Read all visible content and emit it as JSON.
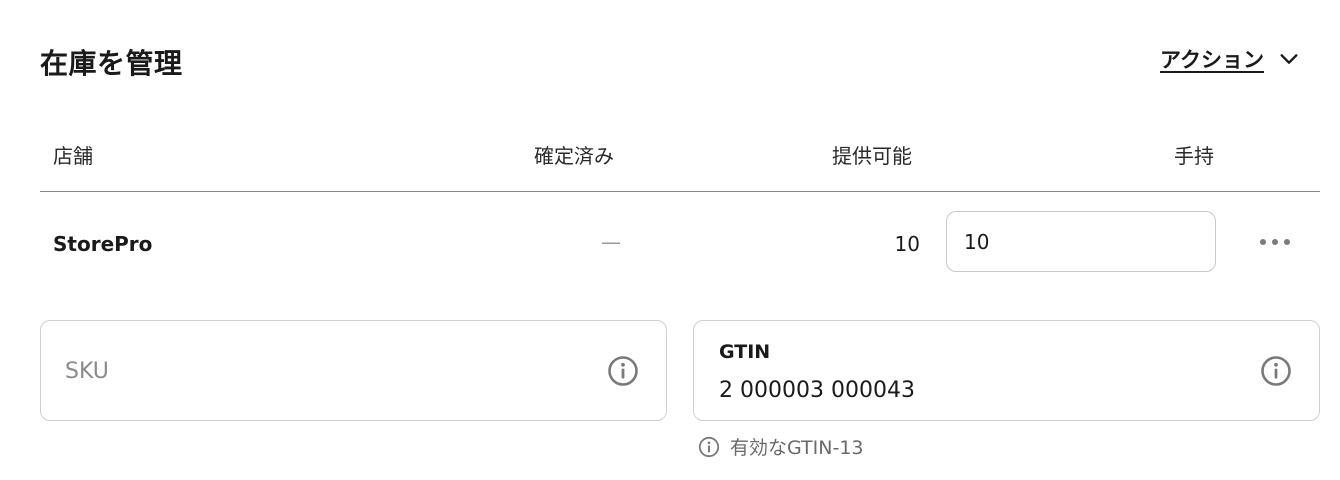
{
  "header": {
    "title": "在庫を管理",
    "actions_label": "アクション"
  },
  "table": {
    "columns": {
      "store": "店舗",
      "committed": "確定済み",
      "available": "提供可能",
      "on_hand": "手持"
    },
    "rows": [
      {
        "store": "StorePro",
        "committed": "—",
        "available": "10",
        "on_hand": "10"
      }
    ]
  },
  "sku": {
    "placeholder": "SKU",
    "value": ""
  },
  "gtin": {
    "label": "GTIN",
    "value": "2 000003 000043",
    "helper": "有効なGTIN-13"
  },
  "icons": {
    "actions": "chevron-down-icon",
    "row_menu": "more-horizontal-icon",
    "info": "info-icon"
  },
  "colors": {
    "text": "#1a1a1a",
    "muted": "#8a8a8a",
    "border": "#cfcfcf"
  }
}
